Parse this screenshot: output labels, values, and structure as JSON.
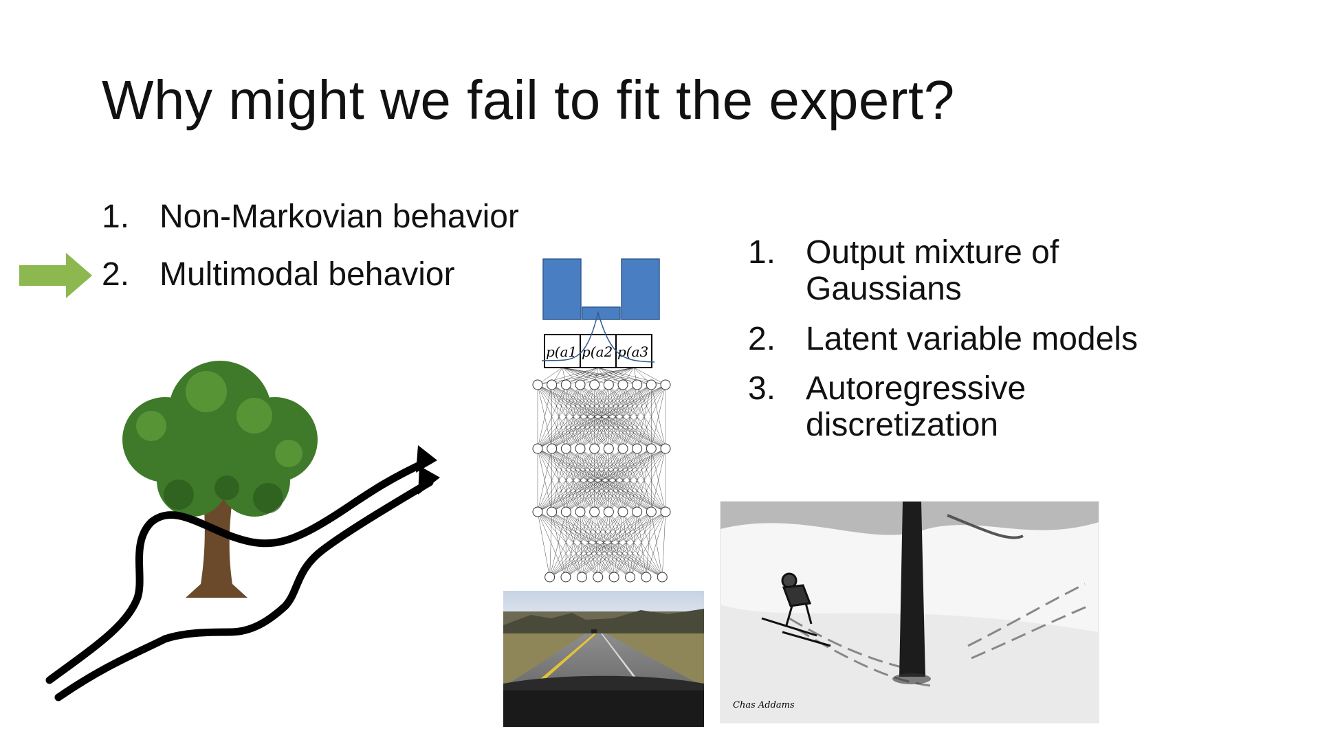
{
  "slide": {
    "title": "Why might we fail to fit the expert?"
  },
  "causes": [
    {
      "num": "1.",
      "label": "Non-Markovian behavior"
    },
    {
      "num": "2.",
      "label": "Multimodal behavior"
    }
  ],
  "solutions": [
    {
      "num": "1.",
      "label": "Output mixture of Gaussians"
    },
    {
      "num": "2.",
      "label": "Latent variable models"
    },
    {
      "num": "3.",
      "label": "Autoregressive discretization"
    }
  ],
  "network": {
    "bin_labels": [
      "p(a1",
      "p(a2",
      "p(a3"
    ]
  },
  "colors": {
    "arrow": "#8CB84F",
    "histogram": "#4A7EC2",
    "histogram_border": "#2F5C8F",
    "tree_foliage": "#3F7A2A",
    "trunk": "#6B4A2B"
  },
  "icons": {
    "pointer": "green-right-arrow-icon"
  }
}
